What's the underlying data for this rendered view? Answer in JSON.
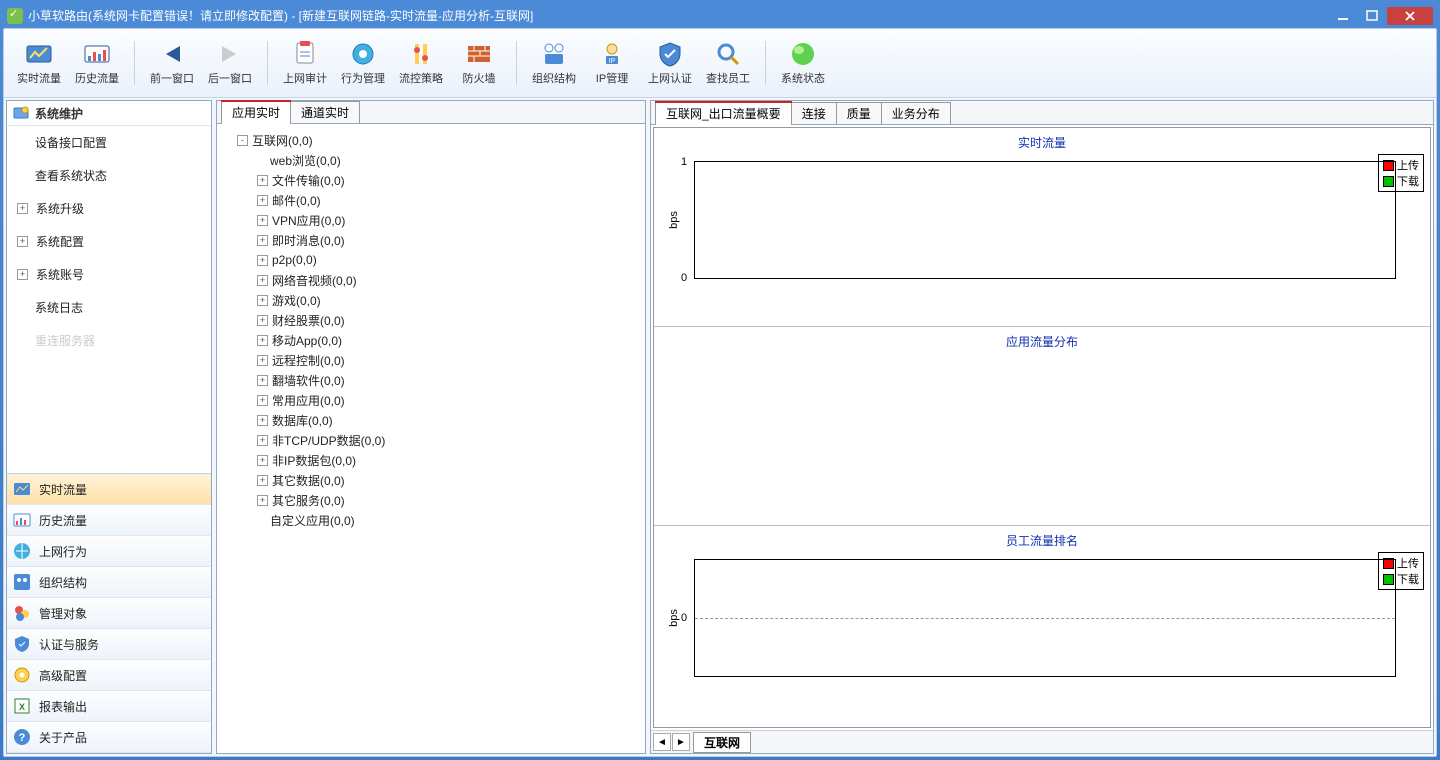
{
  "window": {
    "title": "小草软路由(系统网卡配置错误！请立即修改配置) - [新建互联网链路-实时流量-应用分析-互联网]"
  },
  "toolbar": [
    {
      "label": "实时流量",
      "icon": "realtime-traffic-icon"
    },
    {
      "label": "历史流量",
      "icon": "history-traffic-icon"
    },
    {
      "sep": true
    },
    {
      "label": "前一窗口",
      "icon": "prev-window-icon"
    },
    {
      "label": "后一窗口",
      "icon": "next-window-icon"
    },
    {
      "sep": true
    },
    {
      "label": "上网审计",
      "icon": "audit-icon"
    },
    {
      "label": "行为管理",
      "icon": "behavior-icon"
    },
    {
      "label": "流控策略",
      "icon": "flowcontrol-icon"
    },
    {
      "label": "防火墙",
      "icon": "firewall-icon"
    },
    {
      "sep": true
    },
    {
      "label": "组织结构",
      "icon": "orgchart-icon"
    },
    {
      "label": "IP管理",
      "icon": "ip-mgmt-icon"
    },
    {
      "label": "上网认证",
      "icon": "auth-icon"
    },
    {
      "label": "查找员工",
      "icon": "find-user-icon"
    },
    {
      "sep": true
    },
    {
      "label": "系统状态",
      "icon": "status-icon"
    }
  ],
  "left_top": {
    "header": "系统维护",
    "items": [
      {
        "label": "设备接口配置",
        "expand": null
      },
      {
        "label": "查看系统状态",
        "expand": null
      },
      {
        "label": "系统升级",
        "expand": "collapsed"
      },
      {
        "label": "系统配置",
        "expand": "collapsed"
      },
      {
        "label": "系统账号",
        "expand": "collapsed"
      },
      {
        "label": "系统日志",
        "expand": null
      },
      {
        "label": "重连服务器",
        "expand": null,
        "dim": true
      }
    ]
  },
  "left_categories": [
    {
      "label": "实时流量",
      "active": true,
      "icon": "realtime-traffic-icon"
    },
    {
      "label": "历史流量",
      "icon": "history-traffic-icon"
    },
    {
      "label": "上网行为",
      "icon": "web-behavior-icon"
    },
    {
      "label": "组织结构",
      "icon": "orgchart-icon"
    },
    {
      "label": "管理对象",
      "icon": "manage-objects-icon"
    },
    {
      "label": "认证与服务",
      "icon": "auth-service-icon"
    },
    {
      "label": "高级配置",
      "icon": "advanced-config-icon"
    },
    {
      "label": "报表输出",
      "icon": "report-export-icon"
    },
    {
      "label": "关于产品",
      "icon": "about-icon"
    }
  ],
  "mid_tabs": [
    {
      "label": "应用实时",
      "active": true
    },
    {
      "label": "通道实时"
    }
  ],
  "tree": [
    {
      "label": "互联网(0,0)",
      "exp": "-",
      "ind": 1
    },
    {
      "label": "web浏览(0,0)",
      "exp": "",
      "ind": 2
    },
    {
      "label": "文件传输(0,0)",
      "exp": "+",
      "ind": 2
    },
    {
      "label": "邮件(0,0)",
      "exp": "+",
      "ind": 2
    },
    {
      "label": "VPN应用(0,0)",
      "exp": "+",
      "ind": 2
    },
    {
      "label": "即时消息(0,0)",
      "exp": "+",
      "ind": 2
    },
    {
      "label": "p2p(0,0)",
      "exp": "+",
      "ind": 2
    },
    {
      "label": "网络音视频(0,0)",
      "exp": "+",
      "ind": 2
    },
    {
      "label": "游戏(0,0)",
      "exp": "+",
      "ind": 2
    },
    {
      "label": "财经股票(0,0)",
      "exp": "+",
      "ind": 2
    },
    {
      "label": "移动App(0,0)",
      "exp": "+",
      "ind": 2
    },
    {
      "label": "远程控制(0,0)",
      "exp": "+",
      "ind": 2
    },
    {
      "label": "翻墙软件(0,0)",
      "exp": "+",
      "ind": 2
    },
    {
      "label": "常用应用(0,0)",
      "exp": "+",
      "ind": 2
    },
    {
      "label": "数据库(0,0)",
      "exp": "+",
      "ind": 2
    },
    {
      "label": "非TCP/UDP数据(0,0)",
      "exp": "+",
      "ind": 2
    },
    {
      "label": "非IP数据包(0,0)",
      "exp": "+",
      "ind": 2
    },
    {
      "label": "其它数据(0,0)",
      "exp": "+",
      "ind": 2
    },
    {
      "label": "其它服务(0,0)",
      "exp": "+",
      "ind": 2
    },
    {
      "label": "自定义应用(0,0)",
      "exp": "",
      "ind": 2
    }
  ],
  "right_tabs": [
    {
      "label": "互联网_出口流量概要",
      "active": true
    },
    {
      "label": "连接"
    },
    {
      "label": "质量"
    },
    {
      "label": "业务分布"
    }
  ],
  "panels": {
    "p1": {
      "title": "实时流量",
      "ylabel": "bps",
      "y0": "0",
      "y1": "1",
      "legend_up": "上传",
      "legend_dn": "下载"
    },
    "p2": {
      "title": "应用流量分布"
    },
    "p3": {
      "title": "员工流量排名",
      "ylabel": "bps",
      "y0": "0",
      "legend_up": "上传",
      "legend_dn": "下载"
    }
  },
  "bottom_tab": "互联网",
  "chart_data": [
    {
      "type": "line",
      "title": "实时流量",
      "ylabel": "bps",
      "ylim": [
        0,
        1
      ],
      "series": [
        {
          "name": "上传",
          "values": []
        },
        {
          "name": "下载",
          "values": []
        }
      ]
    },
    {
      "type": "bar",
      "title": "应用流量分布",
      "categories": [],
      "values": []
    },
    {
      "type": "bar",
      "title": "员工流量排名",
      "ylabel": "bps",
      "series": [
        {
          "name": "上传",
          "values": []
        },
        {
          "name": "下载",
          "values": []
        }
      ]
    }
  ],
  "colors": {
    "upload": "#ff0000",
    "download": "#00c000",
    "accent": "#1030b0"
  }
}
